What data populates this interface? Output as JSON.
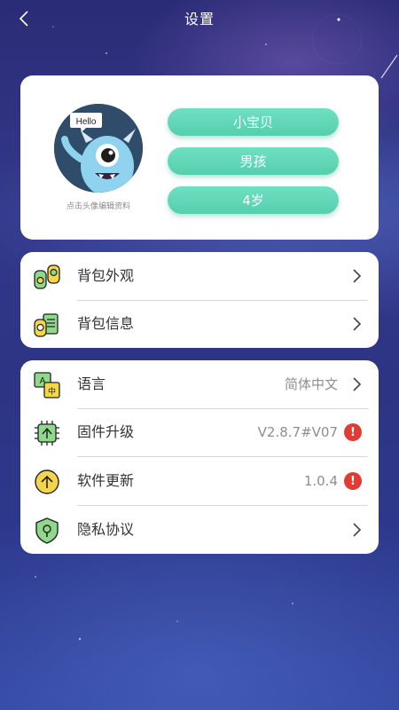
{
  "header": {
    "title": "设置",
    "back_icon": "chevron-left-icon"
  },
  "profile": {
    "avatar_speech": "Hello",
    "avatar_hint": "点击头像编辑资料",
    "name": "小宝贝",
    "gender": "男孩",
    "age": "4岁"
  },
  "backpack": {
    "items": [
      {
        "label": "背包外观",
        "icon": "backpack-appearance-icon"
      },
      {
        "label": "背包信息",
        "icon": "backpack-info-icon"
      }
    ]
  },
  "settings": {
    "language": {
      "label": "语言",
      "value": "简体中文",
      "icon": "language-icon"
    },
    "firmware": {
      "label": "固件升级",
      "value": "V2.8.7#V07",
      "icon": "firmware-chip-icon",
      "badge": "!"
    },
    "software": {
      "label": "软件更新",
      "value": "1.0.4",
      "icon": "software-update-icon",
      "badge": "!"
    },
    "privacy": {
      "label": "隐私协议",
      "icon": "privacy-shield-icon"
    }
  },
  "colors": {
    "accent_green": "#55cfae",
    "alert_red": "#e23b33",
    "background_navy": "#2d3483"
  }
}
